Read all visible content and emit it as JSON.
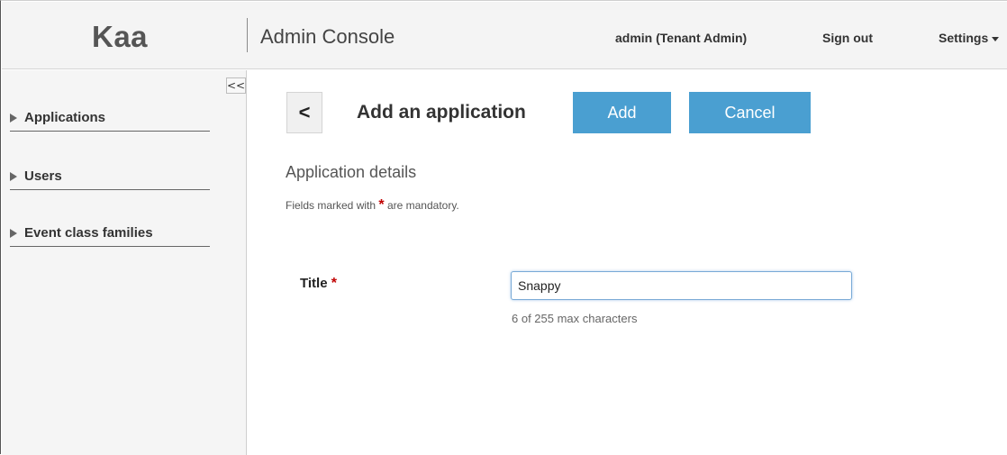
{
  "header": {
    "logo": "Kaa",
    "console_title": "Admin Console",
    "user_label": "admin (Tenant Admin)",
    "signout_label": "Sign out",
    "settings_label": "Settings"
  },
  "sidebar": {
    "collapse_label": "<<",
    "items": [
      {
        "label": "Applications"
      },
      {
        "label": "Users"
      },
      {
        "label": "Event class families"
      }
    ]
  },
  "main": {
    "back_label": "<",
    "page_title": "Add an application",
    "add_label": "Add",
    "cancel_label": "Cancel",
    "section_title": "Application details",
    "mandatory_prefix": "Fields marked with",
    "mandatory_star": "*",
    "mandatory_suffix": "are mandatory.",
    "form": {
      "title_label": "Title",
      "required_star": "*",
      "title_value": "Snappy",
      "char_count": "6 of 255 max characters"
    }
  },
  "colors": {
    "primary_button": "#4a9fd1",
    "required_star": "#c00000",
    "header_bg": "#f4f4f4",
    "sidebar_bg": "#f5f5f5"
  }
}
